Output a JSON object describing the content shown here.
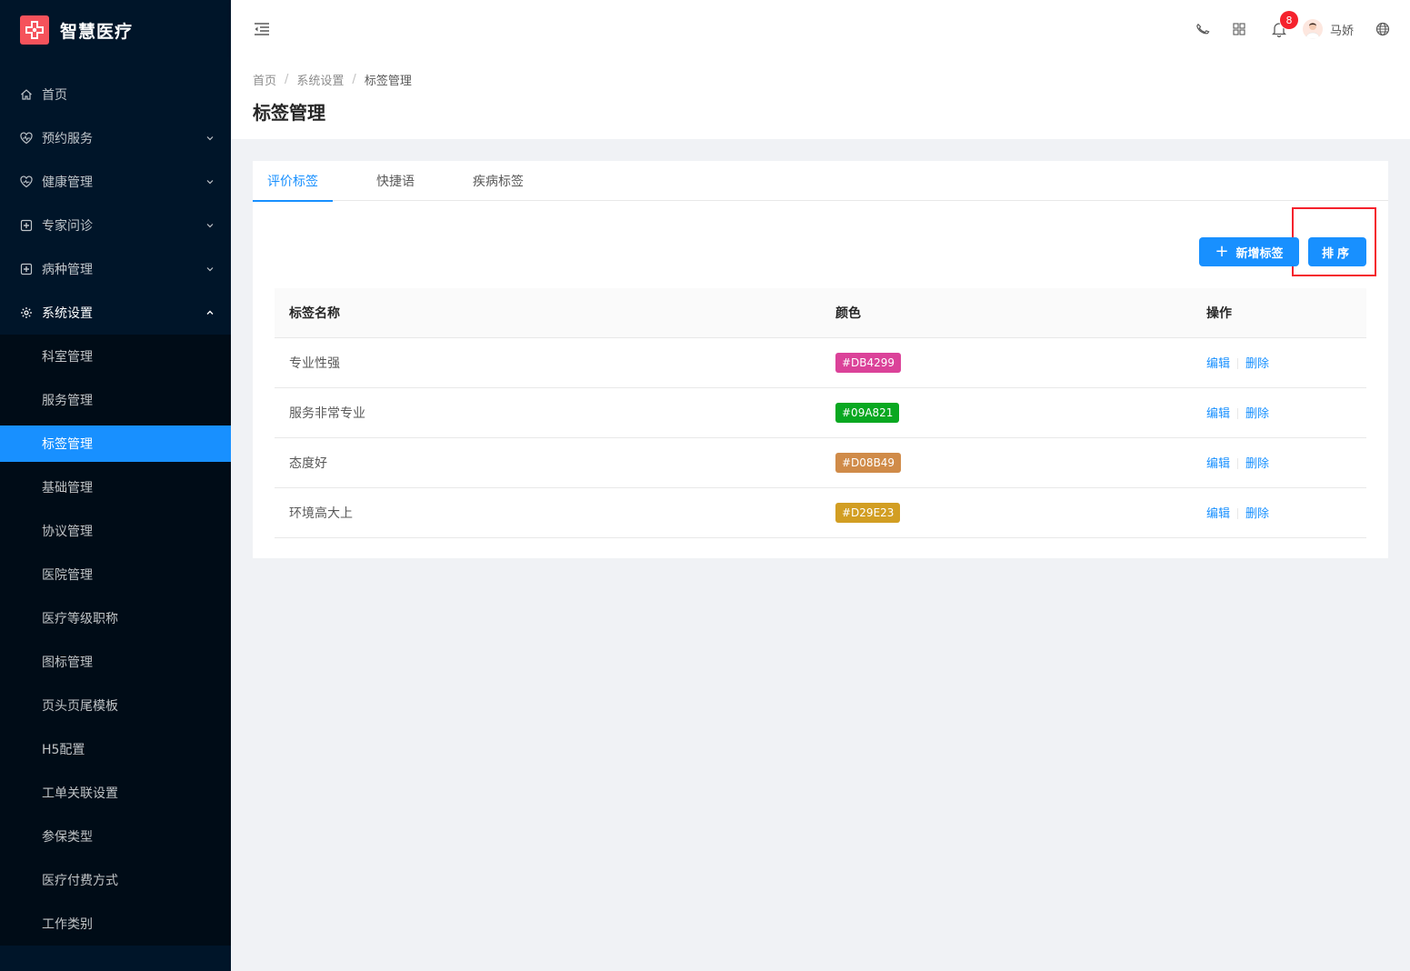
{
  "app": {
    "name": "智慧医疗"
  },
  "sidebar": {
    "items": [
      {
        "label": "首页",
        "icon": "home-icon"
      },
      {
        "label": "预约服务",
        "icon": "heart-rate-icon"
      },
      {
        "label": "健康管理",
        "icon": "heart-icon"
      },
      {
        "label": "专家问诊",
        "icon": "medical-plus-icon"
      },
      {
        "label": "病种管理",
        "icon": "medical-plus-icon"
      },
      {
        "label": "系统设置",
        "icon": "gear-icon"
      }
    ],
    "subitems": [
      {
        "label": "科室管理"
      },
      {
        "label": "服务管理"
      },
      {
        "label": "标签管理"
      },
      {
        "label": "基础管理"
      },
      {
        "label": "协议管理"
      },
      {
        "label": "医院管理"
      },
      {
        "label": "医疗等级职称"
      },
      {
        "label": "图标管理"
      },
      {
        "label": "页头页尾模板"
      },
      {
        "label": "H5配置"
      },
      {
        "label": "工单关联设置"
      },
      {
        "label": "参保类型"
      },
      {
        "label": "医疗付费方式"
      },
      {
        "label": "工作类别"
      }
    ]
  },
  "header": {
    "notification_count": "8",
    "user_name": "马娇"
  },
  "breadcrumb": {
    "items": [
      "首页",
      "系统设置",
      "标签管理"
    ]
  },
  "page": {
    "title": "标签管理"
  },
  "tabs": [
    "评价标签",
    "快捷语",
    "疾病标签"
  ],
  "toolbar": {
    "add_label": "新增标签",
    "sort_label": "排序"
  },
  "table": {
    "headers": [
      "标签名称",
      "颜色",
      "操作"
    ],
    "rows": [
      {
        "name": "专业性强",
        "color": "#DB4299"
      },
      {
        "name": "服务非常专业",
        "color": "#09A821"
      },
      {
        "name": "态度好",
        "color": "#D08B49"
      },
      {
        "name": "环境高大上",
        "color": "#D29E23"
      }
    ],
    "edit_label": "编辑",
    "delete_label": "删除"
  },
  "colors": {
    "primary": "#1890ff",
    "sidebar_bg": "#001529",
    "logo": "#f5525b",
    "highlight": "#f5222d"
  }
}
